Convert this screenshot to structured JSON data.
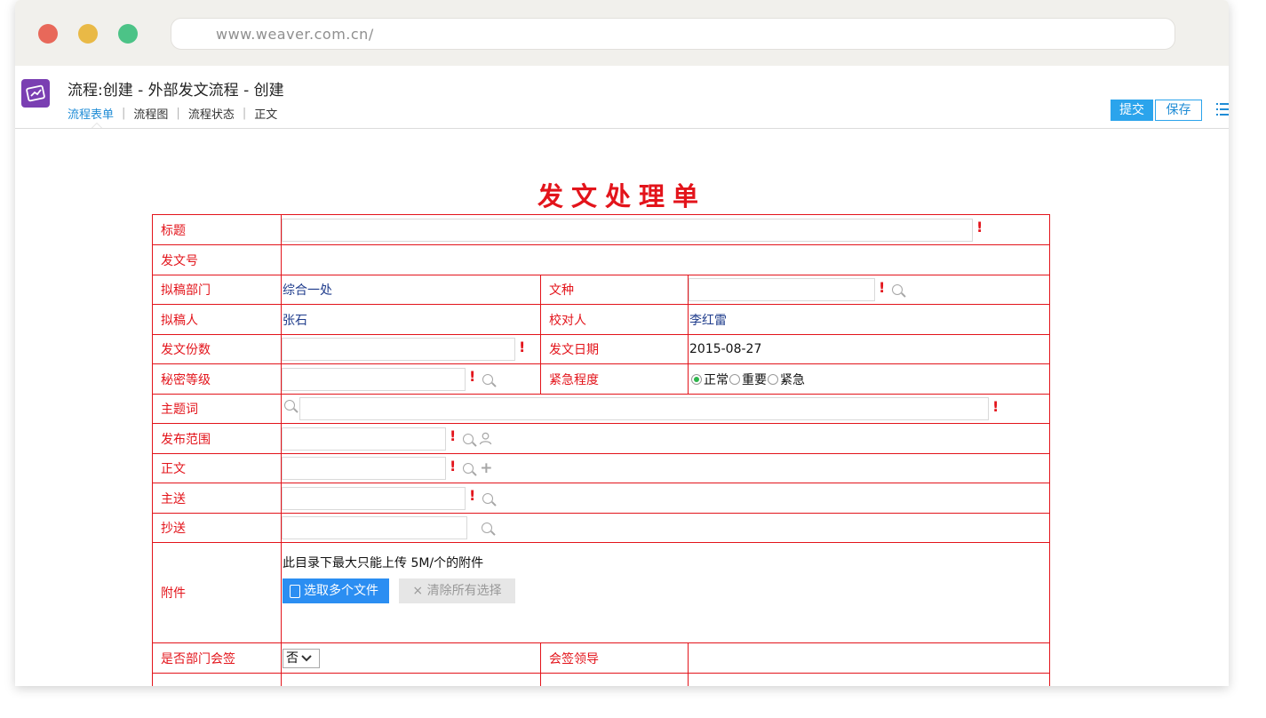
{
  "browser": {
    "url": "www.weaver.com.cn/"
  },
  "app": {
    "title": "流程:创建 - 外部发文流程 - 创建",
    "tabs": [
      "流程表单",
      "流程图",
      "流程状态",
      "正文"
    ],
    "submit_label": "提交",
    "save_label": "保存"
  },
  "form": {
    "title": "发文处理单",
    "labels": {
      "title": "标题",
      "doc_no": "发文号",
      "draft_dept": "拟稿部门",
      "doc_type": "文种",
      "drafter": "拟稿人",
      "proofreader": "校对人",
      "copies": "发文份数",
      "issue_date": "发文日期",
      "secret_level": "秘密等级",
      "urgency": "紧急程度",
      "keywords": "主题词",
      "scope": "发布范围",
      "body": "正文",
      "main_send": "主送",
      "cc_send": "抄送",
      "attachment": "附件",
      "dept_countersign": "是否部门会签",
      "countersign_leader": "会签领导"
    },
    "values": {
      "draft_dept": "综合一处",
      "drafter": "张石",
      "proofreader": "李红雷",
      "issue_date": "2015-08-27",
      "dept_countersign": "否"
    },
    "urgency_options": [
      "正常",
      "重要",
      "紧急"
    ],
    "urgency_selected": "正常",
    "attachment": {
      "note": "此目录下最大只能上传 5M/个的附件",
      "select_files": "选取多个文件",
      "clear_all": "× 清除所有选择"
    }
  }
}
